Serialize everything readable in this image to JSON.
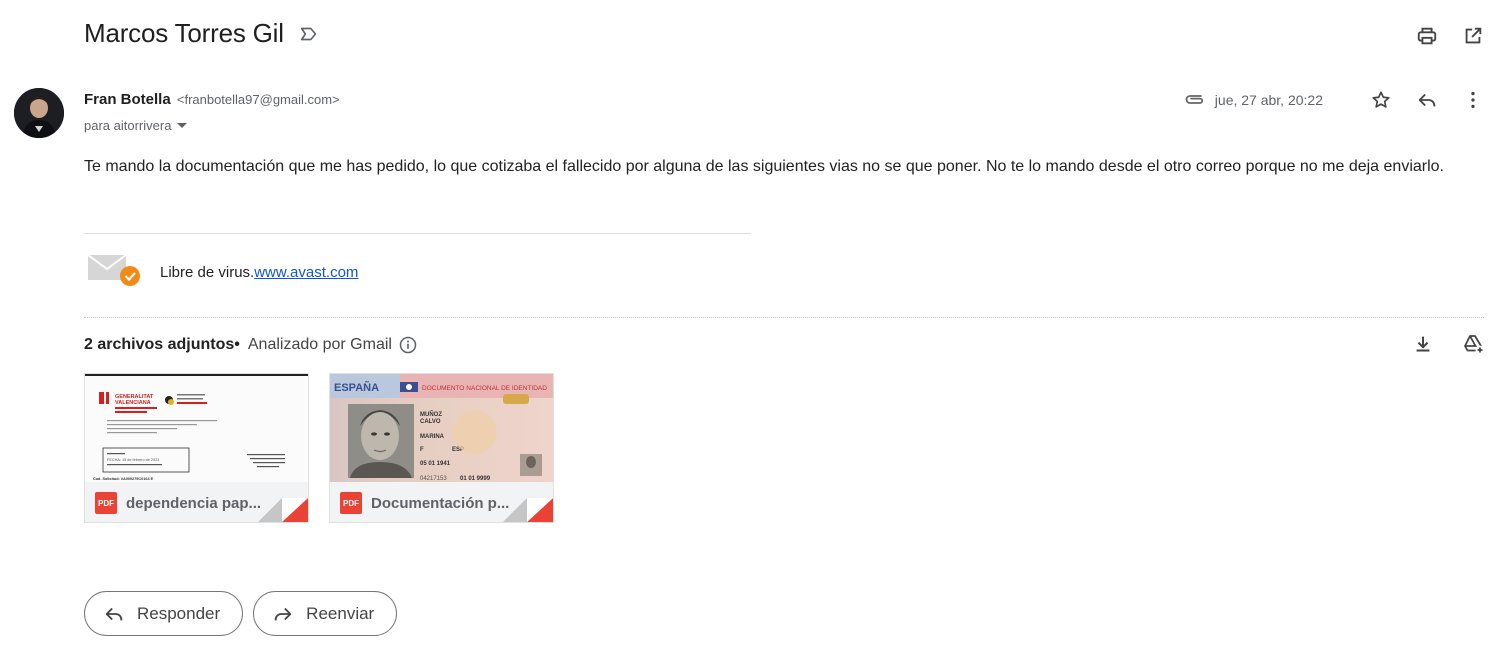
{
  "subject": "Marcos Torres Gil",
  "sender": {
    "name": "Fran Botella",
    "email": "<franbotella97@gmail.com>",
    "recipient": "para aitorrivera",
    "date": "jue, 27 abr, 20:22"
  },
  "message": {
    "body": "Te mando la documentación que me has pedido, lo que cotizaba el fallecido por alguna de las siguientes vias no se que poner. No te lo mando desde el otro correo porque no me deja enviarlo."
  },
  "signature": {
    "text": "Libre de virus.",
    "link": "www.avast.com"
  },
  "attachments": {
    "count_label": "2 archivos adjuntos",
    "separator": "•",
    "scan_label": "Analizado por Gmail",
    "items": [
      {
        "name": "dependencia pap...",
        "type": "PDF"
      },
      {
        "name": "Documentación p...",
        "type": "PDF"
      }
    ],
    "thumb1": {
      "org1": "GENERALITAT",
      "org2": "VALENCIANA",
      "date_line": "FECHA: 15 de febrero de 2023",
      "footer": "Cod. Solicitud: #A009275C0164 E"
    },
    "thumb2": {
      "country": "ESPAÑA",
      "doc_title": "DOCUMENTO NACIONAL DE IDENTIDAD",
      "surname1": "MUÑOZ",
      "surname2": "CALVO",
      "given": "MARINA",
      "sex": "F",
      "nationality": "ESP",
      "birth": "05 01 1941",
      "number": "04217153",
      "valid": "01 01 9999"
    }
  },
  "buttons": {
    "reply": "Responder",
    "forward": "Reenviar"
  },
  "icons": [
    "label-icon",
    "print-icon",
    "open-new-window-icon",
    "paperclip-icon",
    "star-icon",
    "reply-icon",
    "more-vert-icon",
    "info-icon",
    "download-icon",
    "add-to-drive-icon",
    "pdf-icon"
  ]
}
